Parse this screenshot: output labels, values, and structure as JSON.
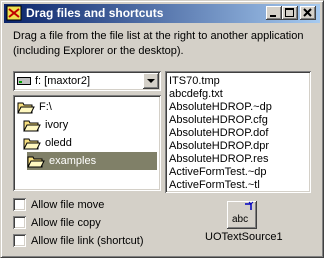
{
  "window": {
    "title": "Drag files and shortcuts",
    "description": "Drag a file from the file list at the right to another application (including Explorer or the desktop)."
  },
  "drive": {
    "value": "f: [maxtor2]"
  },
  "directories": [
    {
      "label": "F:\\",
      "selected": false
    },
    {
      "label": "ivory",
      "selected": false
    },
    {
      "label": "oledd",
      "selected": false
    },
    {
      "label": "examples",
      "selected": true
    }
  ],
  "files": [
    "ITS70.tmp",
    "abcdefg.txt",
    "AbsoluteHDROP.~dp",
    "AbsoluteHDROP.cfg",
    "AbsoluteHDROP.dof",
    "AbsoluteHDROP.dpr",
    "AbsoluteHDROP.res",
    "ActiveFormTest.~dp",
    "ActiveFormTest.~tl"
  ],
  "options": [
    {
      "label": "Allow file move",
      "checked": false
    },
    {
      "label": "Allow file copy",
      "checked": false
    },
    {
      "label": "Allow file link (shortcut)",
      "checked": false
    }
  ],
  "component": {
    "icon_text": "abc",
    "name": "UOTextSource1"
  },
  "icons": {
    "app": "app-icon",
    "folder": "folder-icon",
    "drive": "drive-icon"
  }
}
